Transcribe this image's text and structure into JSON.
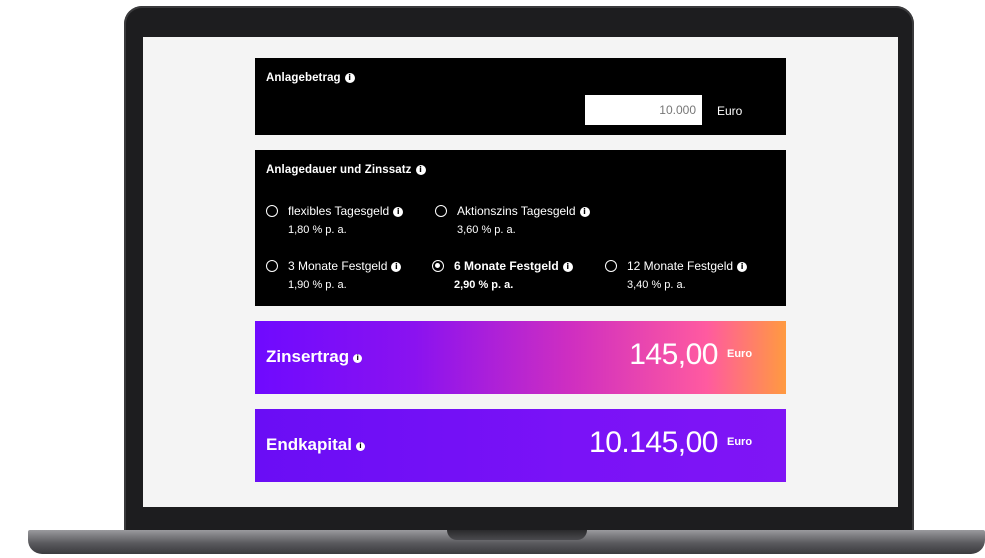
{
  "amount": {
    "title": "Anlagebetrag",
    "value": "10.000",
    "unit": "Euro"
  },
  "duration": {
    "title": "Anlagedauer und Zinssatz",
    "options": [
      {
        "label": "flexibles Tagesgeld",
        "rate": "1,80 % p. a.",
        "selected": false
      },
      {
        "label": "Aktionszins Tagesgeld",
        "rate": "3,60 % p. a.",
        "selected": false
      },
      {
        "label": "3 Monate Festgeld",
        "rate": "1,90 % p. a.",
        "selected": false
      },
      {
        "label": "6 Monate Festgeld",
        "rate": "2,90 % p. a.",
        "selected": true
      },
      {
        "label": "12 Monate Festgeld",
        "rate": "3,40 % p. a.",
        "selected": false
      }
    ]
  },
  "interest": {
    "label": "Zinsertrag",
    "value": "145,00",
    "unit": "Euro"
  },
  "capital": {
    "label": "Endkapital",
    "value": "10.145,00",
    "unit": "Euro"
  },
  "icons": {
    "info": "info-icon",
    "info_glyph": "i"
  },
  "colors": {
    "panel_dark": "#000000",
    "interest_gradient_start": "#6f0aff",
    "interest_gradient_end": "#ff9a40",
    "capital_bg": "#7a12f7"
  }
}
